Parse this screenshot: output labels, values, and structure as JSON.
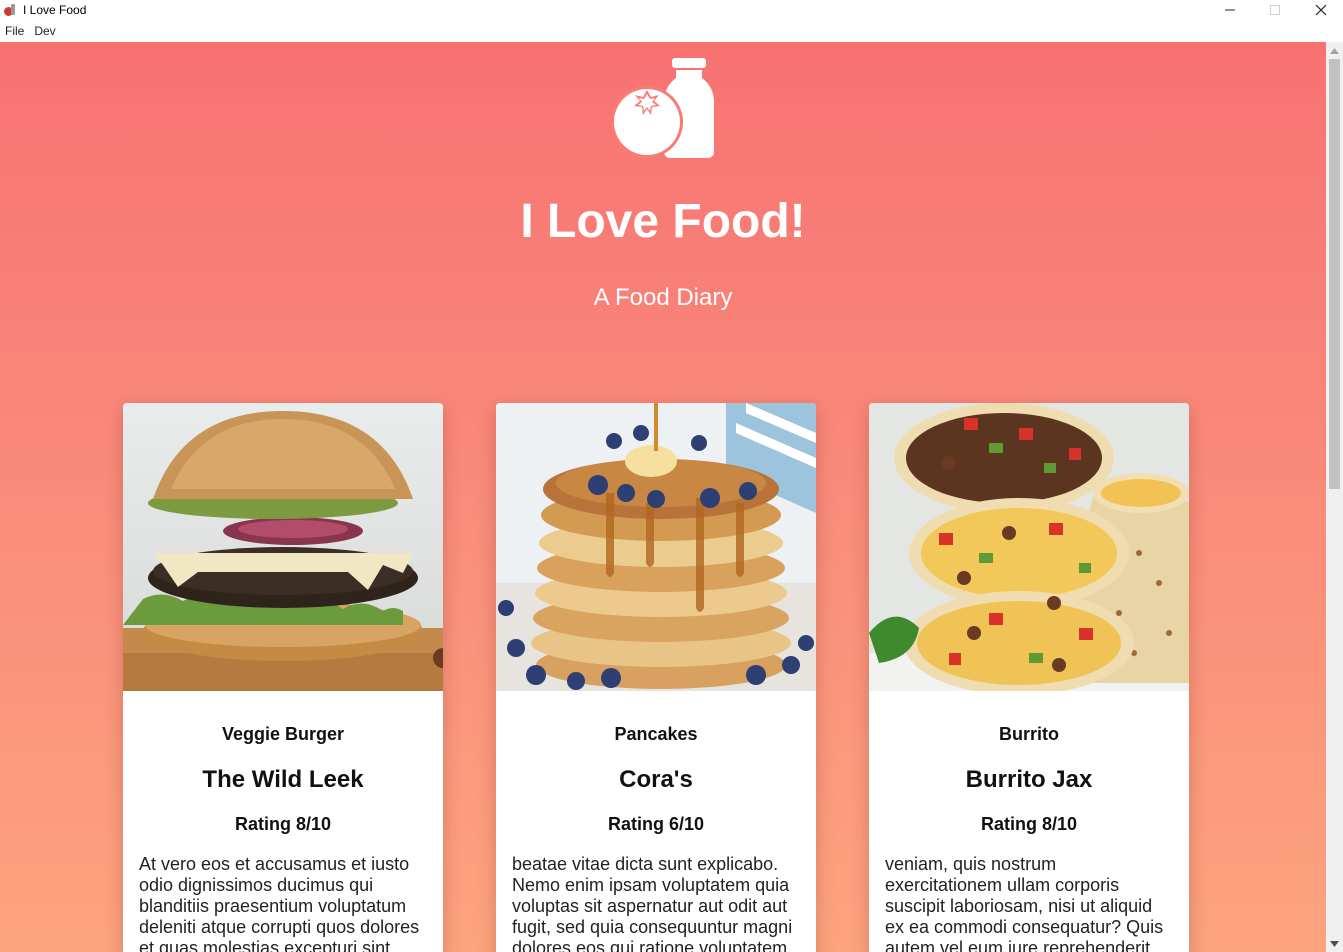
{
  "window": {
    "title": "I Love Food"
  },
  "menu": [
    "File",
    "Dev"
  ],
  "hero": {
    "title": "I Love Food!",
    "subtitle": "A Food Diary"
  },
  "cards": [
    {
      "dish": "Veggie Burger",
      "place": "The Wild Leek",
      "rating": "Rating 8/10",
      "description": "At vero eos et accusamus et iusto odio dignissimos ducimus qui blanditiis praesentium voluptatum deleniti atque corrupti quos dolores et quas molestias excepturi sint"
    },
    {
      "dish": "Pancakes",
      "place": "Cora's",
      "rating": "Rating 6/10",
      "description": "beatae vitae dicta sunt explicabo. Nemo enim ipsam voluptatem quia voluptas sit aspernatur aut odit aut fugit, sed quia consequuntur magni dolores eos qui ratione voluptatem."
    },
    {
      "dish": "Burrito",
      "place": "Burrito Jax",
      "rating": "Rating 8/10",
      "description": "veniam, quis nostrum exercitationem ullam corporis suscipit laboriosam, nisi ut aliquid ex ea commodi consequatur? Quis autem vel eum iure reprehenderit"
    }
  ],
  "icons": {
    "app": "tomato-bottle-icon",
    "logo": "tomato-bottle-logo",
    "minimize": "minimize-icon",
    "maximize": "maximize-icon",
    "close": "close-icon"
  },
  "colors": {
    "gradient_top": "#f87272",
    "gradient_bottom": "#fca47e",
    "card_bg": "#ffffff",
    "hero_text": "#ffffff"
  }
}
